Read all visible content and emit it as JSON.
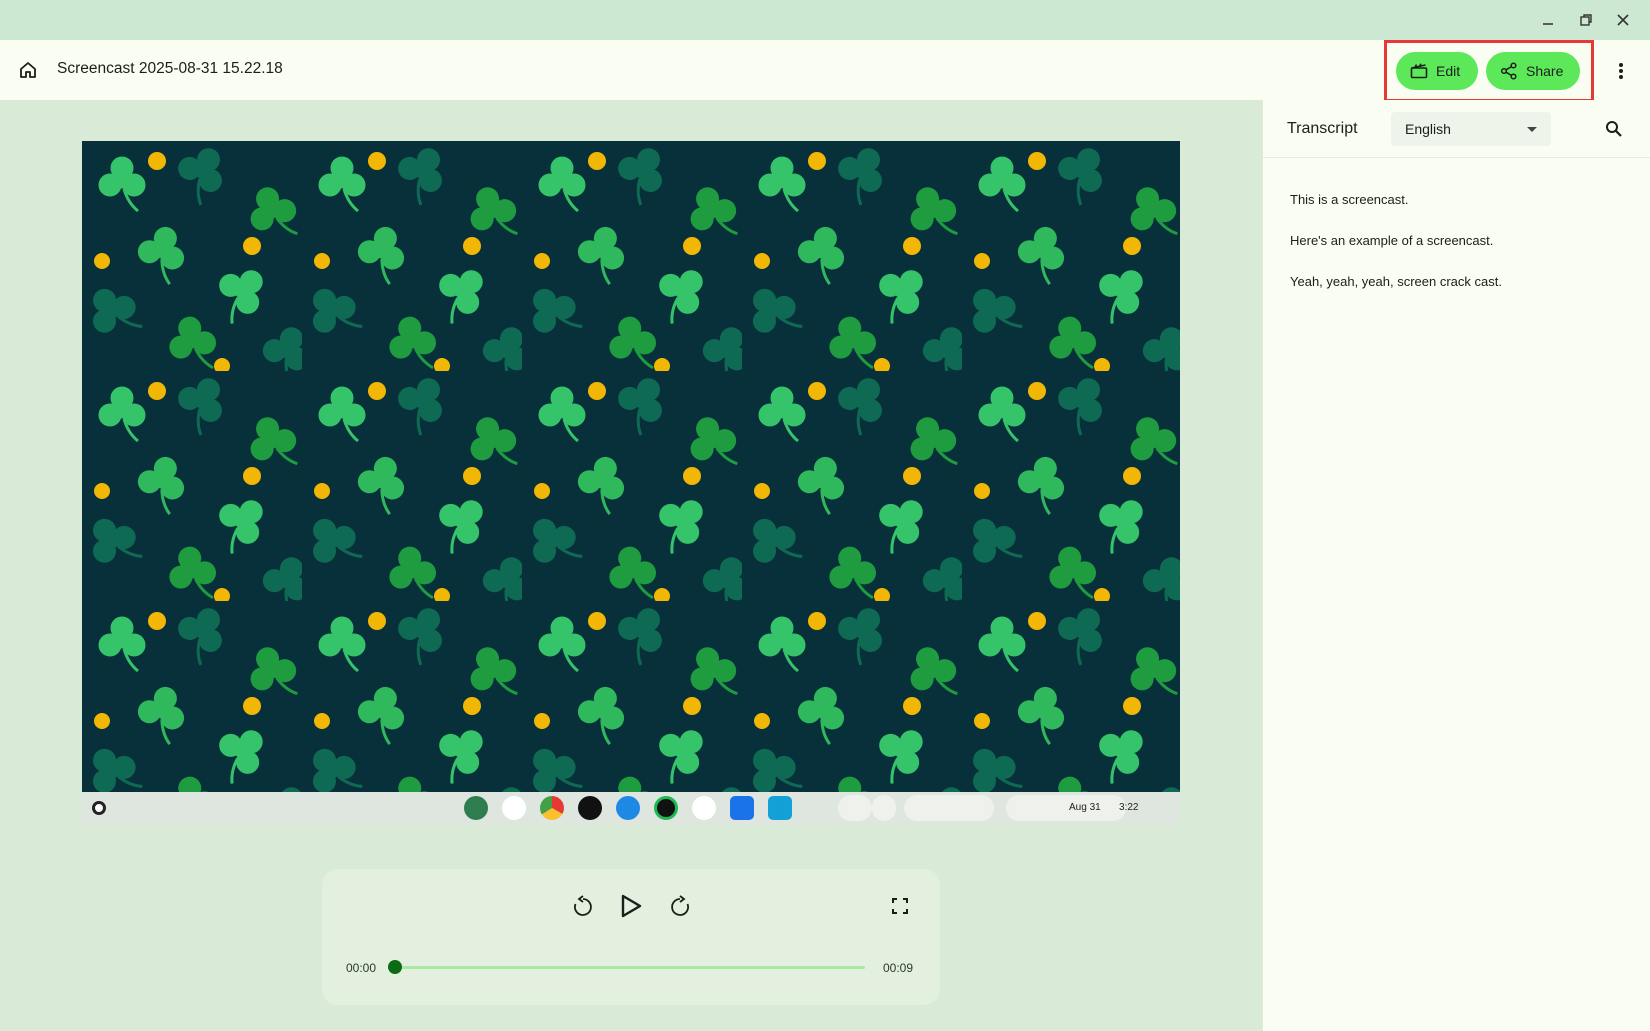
{
  "window": {
    "minimize_icon": "minimize-icon",
    "restore_icon": "restore-icon",
    "close_icon": "close-icon"
  },
  "appbar": {
    "title": "Screencast 2025-08-31 15.22.18",
    "edit_label": "Edit",
    "share_label": "Share",
    "pill_color": "#5de85a",
    "highlight_color": "#e53935"
  },
  "shelf": {
    "date": "Aug 31",
    "time": "3:22"
  },
  "player": {
    "current_time": "00:00",
    "duration": "00:09",
    "progress": 0
  },
  "transcript": {
    "title": "Transcript",
    "language": "English",
    "lines": [
      "This is a screencast.",
      "Here's an example of a screencast.",
      "Yeah, yeah, yeah, screen crack cast."
    ]
  },
  "colors": {
    "titlebar": "#cce8d2",
    "background": "#d9ebd6",
    "panel": "#fafdf2",
    "video_bg": "#07303a",
    "clover_light": "#36c46a",
    "clover_mid": "#1f9b40",
    "clover_dark": "#0e6a52",
    "coin": "#f2b705"
  }
}
